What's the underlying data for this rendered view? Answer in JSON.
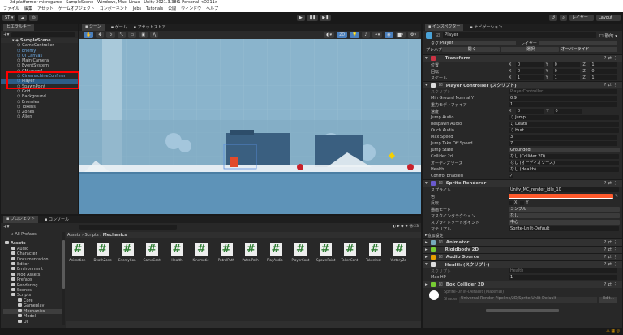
{
  "window": {
    "title": "2d-platformer-microgame - SampleScene - Windows, Mac, Linux - Unity 2021.3.38f1 Personal <DX11>"
  },
  "menu": [
    "ファイル",
    "編集",
    "アセット",
    "ゲームオブジェクト",
    "コンポーネント",
    "Jobs",
    "Tutorials",
    "公開",
    "ウィンドウ",
    "ヘルプ"
  ],
  "toolbar": {
    "account": "ST ▾",
    "layers": "レイヤー",
    "layout": "Layout"
  },
  "hierarchy": {
    "tab": "ヒエラルキー",
    "scene": "SampleScene",
    "items": [
      {
        "label": "GameController",
        "kind": "normal"
      },
      {
        "label": "Enemy",
        "kind": "prefab"
      },
      {
        "label": "UI Canvas",
        "kind": "prefab"
      },
      {
        "label": "Main Camera",
        "kind": "normal"
      },
      {
        "label": "EventSystem",
        "kind": "normal"
      },
      {
        "label": "CM vcam1",
        "kind": "normal"
      },
      {
        "label": "CinemachineConfiner",
        "kind": "prefab"
      },
      {
        "label": "Player",
        "kind": "selected"
      },
      {
        "label": "SpawnPoint",
        "kind": "normal"
      },
      {
        "label": "Grid",
        "kind": "normal"
      },
      {
        "label": "Background",
        "kind": "normal"
      },
      {
        "label": "Enemies",
        "kind": "normal"
      },
      {
        "label": "Tokens",
        "kind": "normal"
      },
      {
        "label": "Zones",
        "kind": "normal"
      },
      {
        "label": "Alien",
        "kind": "normal"
      }
    ]
  },
  "scene": {
    "tabs": [
      "シーン",
      "ゲーム",
      "アセットストア"
    ]
  },
  "project": {
    "tabs": [
      "プロジェクト",
      "コンソール"
    ],
    "all_prefabs": "All Prefabs",
    "tree": [
      {
        "label": "Assets",
        "depth": 0
      },
      {
        "label": "Audio",
        "depth": 1
      },
      {
        "label": "Character",
        "depth": 1
      },
      {
        "label": "Documentation",
        "depth": 1
      },
      {
        "label": "Editor",
        "depth": 1
      },
      {
        "label": "Environment",
        "depth": 1
      },
      {
        "label": "Mod Assets",
        "depth": 1
      },
      {
        "label": "Prefabs",
        "depth": 1
      },
      {
        "label": "Rendering",
        "depth": 1
      },
      {
        "label": "Scenes",
        "depth": 1
      },
      {
        "label": "Scripts",
        "depth": 1
      },
      {
        "label": "Core",
        "depth": 2
      },
      {
        "label": "Gameplay",
        "depth": 2
      },
      {
        "label": "Mechanics",
        "depth": 2,
        "selected": true
      },
      {
        "label": "Model",
        "depth": 2
      },
      {
        "label": "UI",
        "depth": 2
      }
    ],
    "breadcrumb": [
      "Assets",
      "Scripts",
      "Mechanics"
    ],
    "count": "23",
    "assets": [
      "Animation···",
      "DeathZone",
      "EnemyCon···",
      "GameCont···",
      "Health",
      "Kinematic···",
      "PatrolPath",
      "PatrolPath···",
      "PlayAudio···",
      "PlayerCont···",
      "SpawnPoint",
      "TokenCont···",
      "TokenInst···",
      "VictoryZo···"
    ]
  },
  "inspector": {
    "tabs": [
      "インスペクター",
      "ナビゲーション"
    ],
    "name": "Player",
    "static": "静的",
    "tag_label": "タグ",
    "tag": "Player",
    "layer_label": "レイヤー",
    "prefab_label": "プレハブ",
    "prefab_open": "開く",
    "prefab_select": "選択",
    "prefab_override": "オーバーライド",
    "transform": {
      "title": "Transform",
      "rows": [
        {
          "label": "位置",
          "x": "0",
          "y": "0",
          "z": "1"
        },
        {
          "label": "回転",
          "x": "0",
          "y": "0",
          "z": "0"
        },
        {
          "label": "スケール",
          "x": "1",
          "y": "1",
          "z": "1"
        }
      ]
    },
    "player_controller": {
      "title": "Player Controller (スクリプト)",
      "script_label": "スクリプト",
      "script": "PlayerController",
      "rows": [
        {
          "label": "Min Ground Normal Y",
          "value": "0.9"
        },
        {
          "label": "重力モディファイア",
          "value": "1"
        }
      ],
      "velocity_label": "速度",
      "velocity_x": "0",
      "velocity_y": "0",
      "rows2": [
        {
          "label": "Jump Audio",
          "value": "♫ Jump",
          "obj": true
        },
        {
          "label": "Respawn Audio",
          "value": "♫ Death",
          "obj": true
        },
        {
          "label": "Ouch Audio",
          "value": "♫ Hurt",
          "obj": true
        },
        {
          "label": "Max Speed",
          "value": "3"
        },
        {
          "label": "Jump Take Off Speed",
          "value": "7"
        },
        {
          "label": "Jump State",
          "value": "Grounded",
          "dd": true
        },
        {
          "label": "Collider 2d",
          "value": "なし (Collider 2D)",
          "obj": true
        },
        {
          "label": "オーディオソース",
          "value": "なし (オーディオソース)",
          "obj": true
        },
        {
          "label": "Health",
          "value": "なし (Health)",
          "obj": true
        }
      ],
      "control_label": "Control Enabled",
      "control": "✓"
    },
    "sprite_renderer": {
      "title": "Sprite Renderer",
      "sprite_label": "スプライト",
      "sprite": "Unity_MC_render_idle_10",
      "color_label": "色",
      "color": "#ff5a2c",
      "flip_label": "反転",
      "flip_x": "X",
      "flip_y": "Y",
      "rows": [
        {
          "label": "描画モード",
          "value": "シンプル"
        },
        {
          "label": "マスクインタラクション",
          "value": "なし"
        },
        {
          "label": "スプライトソートポイント",
          "value": "中心"
        }
      ],
      "material_label": "マテリアル",
      "material": "Sprite-Unlit-Default",
      "additional": "追加設定"
    },
    "animator": "Animator",
    "rigidbody": "Rigidbody 2D",
    "audio_source": "Audio Source",
    "health": {
      "title": "Health (スクリプト)",
      "script_label": "スクリプト",
      "script": "Health",
      "maxhp_label": "Max HP",
      "maxhp": "1"
    },
    "box_collider": "Box Collider 2D",
    "material": {
      "title": "Sprite-Unlit-Default (Material)",
      "shader_label": "Shader",
      "shader": "Universal Render Pipeline/2D/Sprite-Unlit-Default",
      "edit": "Edit..."
    }
  },
  "colors": {
    "accent": "#2c5d87",
    "highlight": "#ff0000",
    "sky": "#8ab4cc"
  }
}
